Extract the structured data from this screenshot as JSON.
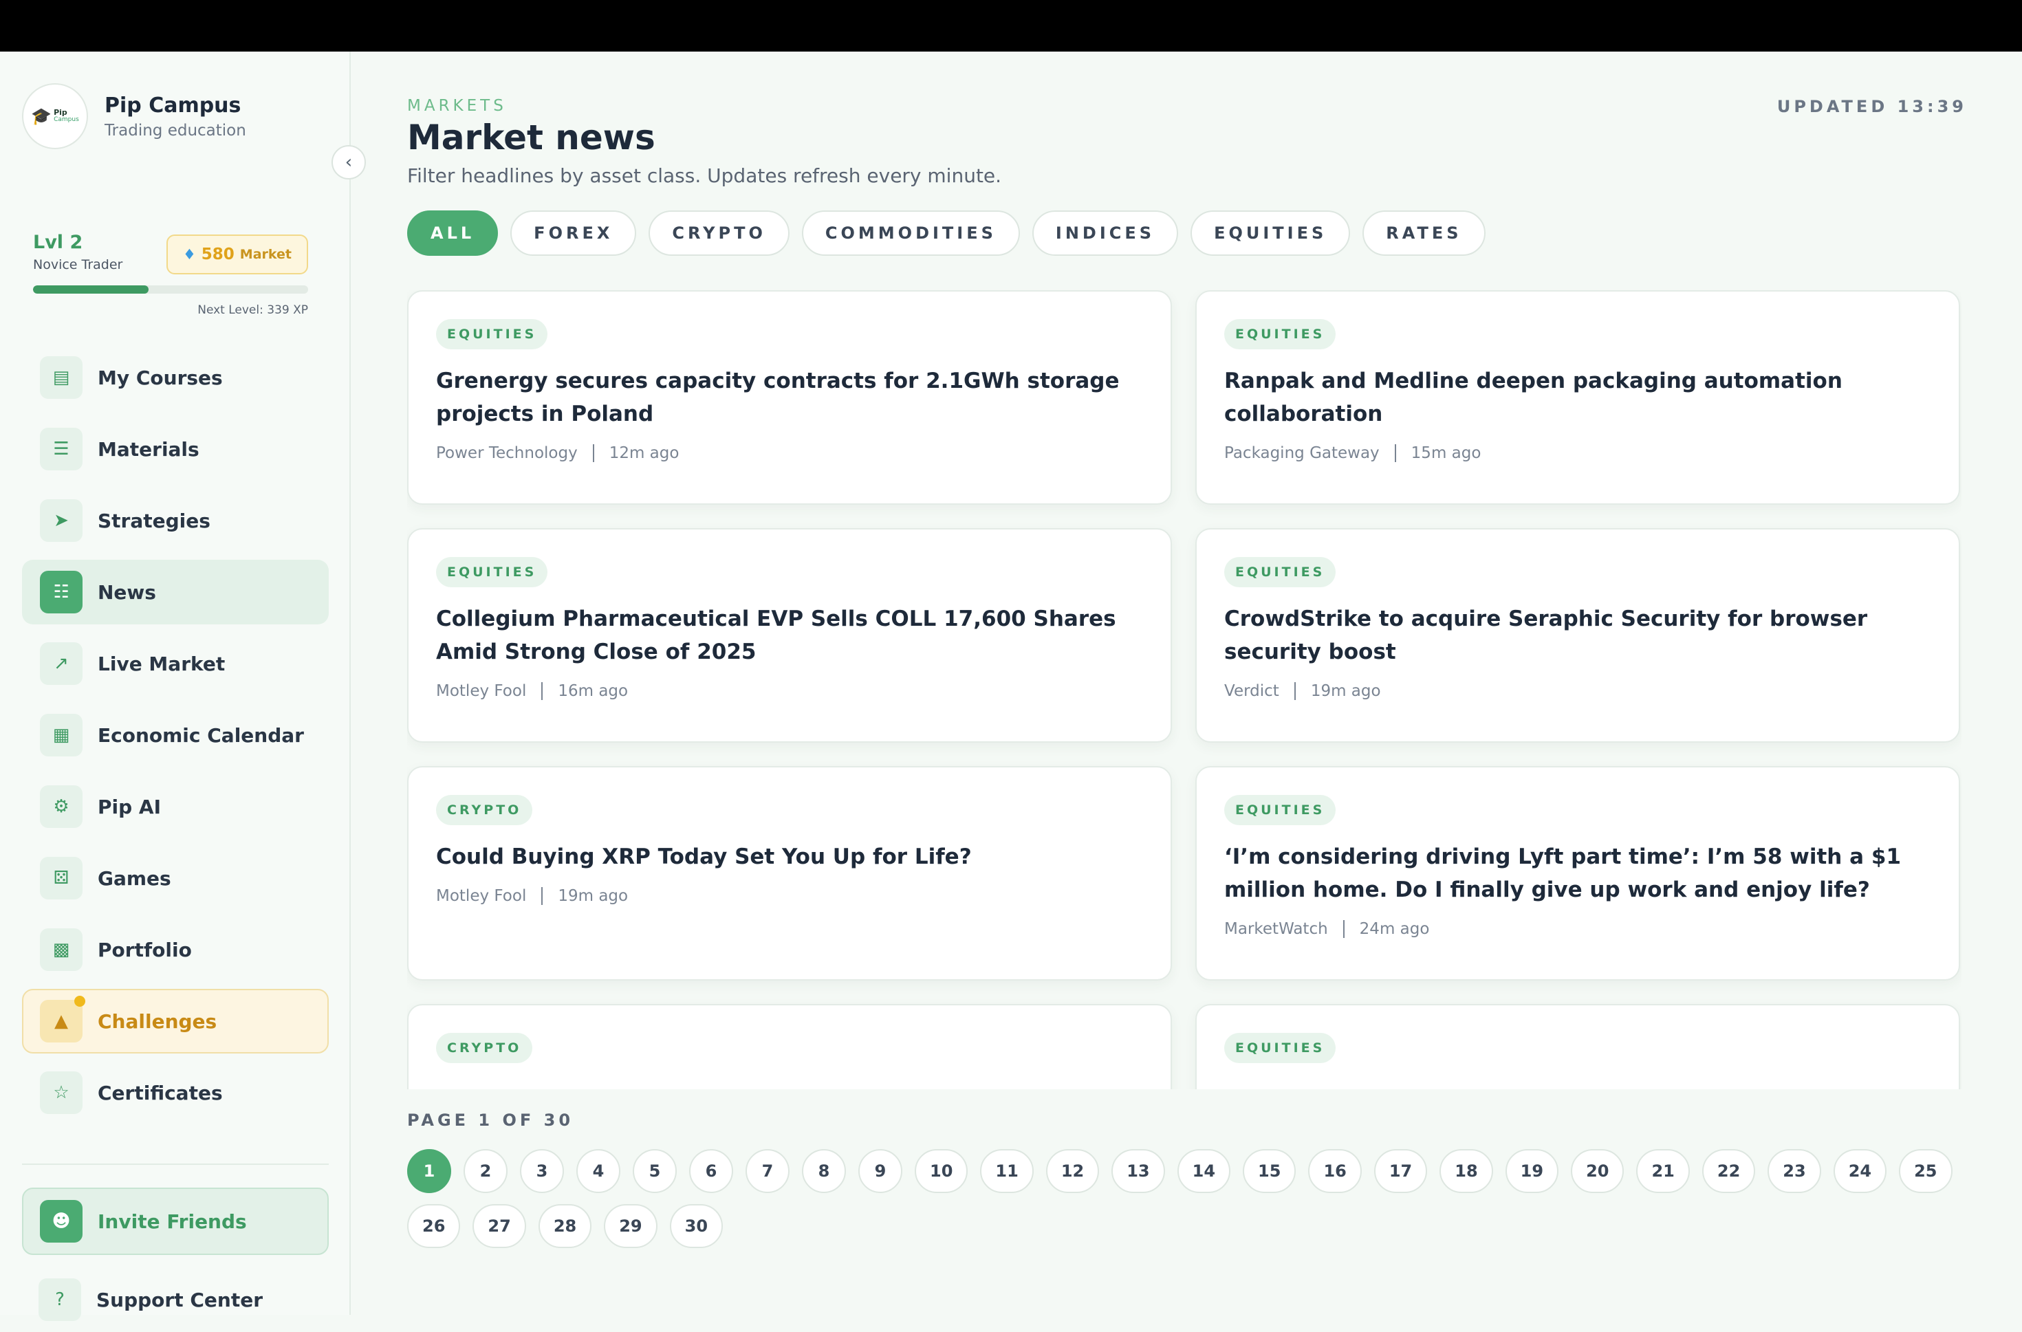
{
  "brand": {
    "name": "Pip Campus",
    "subtitle": "Trading education",
    "logo_text": "Pip",
    "logo_sub": "Campus"
  },
  "level": {
    "title": "Lvl 2",
    "rank": "Novice Trader",
    "gems": "580",
    "gems_label": "Market",
    "next_level": "Next Level: 339 XP",
    "progress_pct": 42
  },
  "nav": [
    {
      "label": "My Courses",
      "icon": "book-icon"
    },
    {
      "label": "Materials",
      "icon": "document-icon"
    },
    {
      "label": "Strategies",
      "icon": "cursor-icon"
    },
    {
      "label": "News",
      "icon": "news-icon"
    },
    {
      "label": "Live Market",
      "icon": "chart-icon"
    },
    {
      "label": "Economic Calendar",
      "icon": "calendar-icon"
    },
    {
      "label": "Pip AI",
      "icon": "robot-icon"
    },
    {
      "label": "Games",
      "icon": "dice-icon"
    },
    {
      "label": "Portfolio",
      "icon": "briefcase-icon"
    },
    {
      "label": "Challenges",
      "icon": "trophy-icon"
    },
    {
      "label": "Certificates",
      "icon": "badge-icon"
    }
  ],
  "invite": {
    "label": "Invite Friends"
  },
  "support": {
    "label": "Support Center"
  },
  "header": {
    "eyebrow": "MARKETS",
    "title": "Market news",
    "subtitle": "Filter headlines by asset class. Updates refresh every minute.",
    "updated": "UPDATED 13:39"
  },
  "filters": [
    "ALL",
    "FOREX",
    "CRYPTO",
    "COMMODITIES",
    "INDICES",
    "EQUITIES",
    "RATES"
  ],
  "news": [
    {
      "tag": "EQUITIES",
      "headline": "Grenergy secures capacity contracts for 2.1GWh storage projects in Poland",
      "source": "Power Technology",
      "time": "12m ago"
    },
    {
      "tag": "EQUITIES",
      "headline": "Ranpak and Medline deepen packaging automation collaboration",
      "source": "Packaging Gateway",
      "time": "15m ago"
    },
    {
      "tag": "EQUITIES",
      "headline": "Collegium Pharmaceutical EVP Sells COLL 17,600 Shares Amid Strong Close of 2025",
      "source": "Motley Fool",
      "time": "16m ago"
    },
    {
      "tag": "EQUITIES",
      "headline": "CrowdStrike to acquire Seraphic Security for browser security boost",
      "source": "Verdict",
      "time": "19m ago"
    },
    {
      "tag": "CRYPTO",
      "headline": "Could Buying XRP Today Set You Up for Life?",
      "source": "Motley Fool",
      "time": "19m ago"
    },
    {
      "tag": "EQUITIES",
      "headline": "‘I’m considering driving Lyft part time’: I’m 58 with a $1 million home. Do I finally give up work and enjoy life?",
      "source": "MarketWatch",
      "time": "24m ago"
    },
    {
      "tag": "CRYPTO",
      "headline": "",
      "source": "",
      "time": ""
    },
    {
      "tag": "EQUITIES",
      "headline": "",
      "source": "",
      "time": ""
    }
  ],
  "pager": {
    "label": "PAGE 1 OF 30",
    "current": 1,
    "total": 30
  }
}
